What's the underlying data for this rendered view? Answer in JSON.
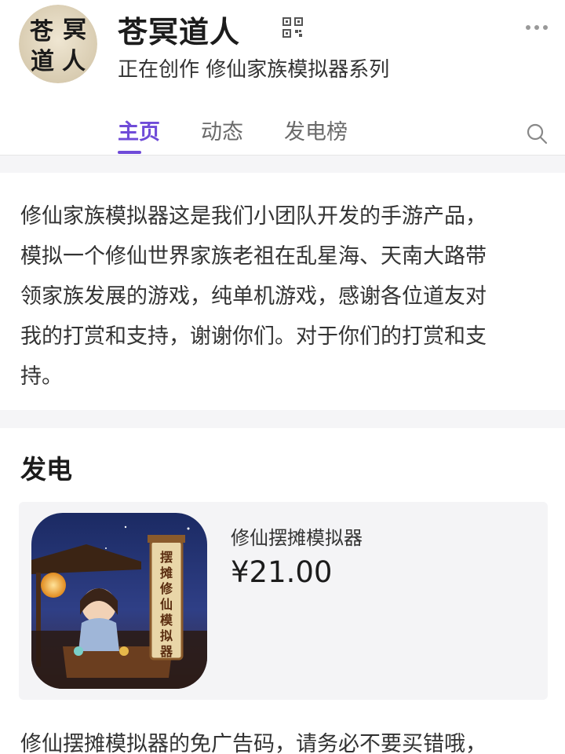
{
  "profile": {
    "avatar_text": "苍冥道人",
    "name": "苍冥道人",
    "subtitle": "正在创作 修仙家族模拟器系列"
  },
  "tabs": [
    {
      "label": "主页",
      "active": true
    },
    {
      "label": "动态",
      "active": false
    },
    {
      "label": "发电榜",
      "active": false
    }
  ],
  "icons": {
    "qr": "qr-code-icon",
    "more": "more-dots-icon",
    "search": "search-icon"
  },
  "accent_color": "#6f4bd8",
  "intro": {
    "lines": [
      "修仙家族模拟器这是我们小团队开发的手游产品，",
      "模拟一个修仙世界家族老祖在乱星海、天南大路带",
      "领家族发展的游戏，纯单机游戏，感谢各位道友对",
      "我的打赏和支持，谢谢你们。对于你们的打赏和支",
      "持。"
    ]
  },
  "support": {
    "title": "发电",
    "product": {
      "name": "修仙摆摊模拟器",
      "price": "¥21.00",
      "image_text": "摆摊修仙模拟器"
    },
    "description": "修仙摆摊模拟器的免广告码，请务必不要买错哦，"
  }
}
